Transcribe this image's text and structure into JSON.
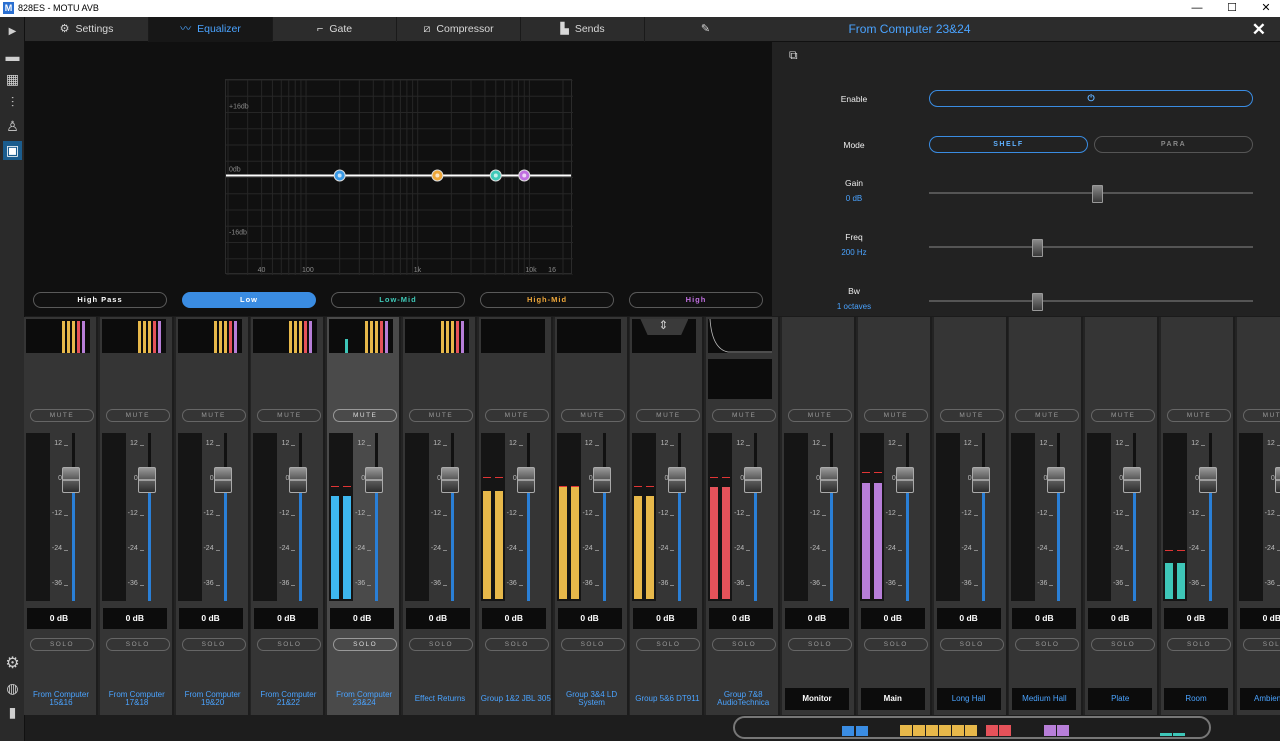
{
  "window": {
    "title": "828ES - MOTU AVB",
    "logo": "M",
    "min": "—",
    "max": "☐",
    "close": "✕"
  },
  "tabs": [
    {
      "label": "Settings",
      "icon": "gear-icon",
      "glyph": "⚙"
    },
    {
      "label": "Equalizer",
      "icon": "eq-curve-icon",
      "glyph": "〰"
    },
    {
      "label": "Gate",
      "icon": "gate-icon",
      "glyph": "⌐"
    },
    {
      "label": "Compressor",
      "icon": "compressor-icon",
      "glyph": "⧄"
    },
    {
      "label": "Sends",
      "icon": "sends-icon",
      "glyph": "▙"
    },
    {
      "label": "",
      "icon": "pencil-icon",
      "glyph": "✎"
    }
  ],
  "channel_header": {
    "name": "From Computer 23&24",
    "close": "✕"
  },
  "eq": {
    "db_labels": [
      "+16db",
      "0db",
      "-16db"
    ],
    "freq_labels": [
      "40",
      "100",
      "1k",
      "10k",
      "16"
    ],
    "bands": [
      {
        "label": "High Pass",
        "color": "#ffffff"
      },
      {
        "label": "Low",
        "color": "#ffffff"
      },
      {
        "label": "Low-Mid",
        "color": "#3fc9b8"
      },
      {
        "label": "High-Mid",
        "color": "#f0a83a"
      },
      {
        "label": "High",
        "color": "#c06fe0"
      }
    ],
    "nodes": [
      {
        "band": "Low",
        "freq_hz": 200,
        "gain_db": 0,
        "color": "#3a9ae6"
      },
      {
        "band": "Low-Mid",
        "freq_hz": 1500,
        "gain_db": 0,
        "color": "#f0a83a"
      },
      {
        "band": "High-Mid",
        "freq_hz": 5000,
        "gain_db": 0,
        "color": "#3fc9b8"
      },
      {
        "band": "High",
        "freq_hz": 9000,
        "gain_db": 0,
        "color": "#c06fe0"
      }
    ]
  },
  "params": {
    "copy_icon": "⧉",
    "enable": {
      "label": "Enable",
      "power": "⏻"
    },
    "mode": {
      "label": "Mode",
      "options": [
        "SHELF",
        "PARA"
      ],
      "selected": "SHELF"
    },
    "gain": {
      "label": "Gain",
      "value": "0 dB",
      "level": 0.52
    },
    "freq": {
      "label": "Freq",
      "value": "200 Hz",
      "level": 0.33
    },
    "bw": {
      "label": "Bw",
      "value": "1 octaves",
      "level": 0.33
    }
  },
  "mixer": {
    "mute_label": "MUTE",
    "solo_label": "SOLO",
    "scale": [
      "12",
      "0",
      "-12",
      "-24",
      "-36"
    ],
    "strips": [
      {
        "name": "From Computer 15&16",
        "db": "0 dB",
        "meter": "#e7b84a",
        "level": 0,
        "peak": null,
        "mini": "bars",
        "style": "blue"
      },
      {
        "name": "From Computer 17&18",
        "db": "0 dB",
        "meter": "#e7b84a",
        "level": 0,
        "peak": null,
        "mini": "bars",
        "style": "blue"
      },
      {
        "name": "From Computer 19&20",
        "db": "0 dB",
        "meter": "#e7b84a",
        "level": 0,
        "peak": null,
        "mini": "bars",
        "style": "blue"
      },
      {
        "name": "From Computer 21&22",
        "db": "0 dB",
        "meter": "#e7b84a",
        "level": 0,
        "peak": null,
        "mini": "bars",
        "style": "blue"
      },
      {
        "name": "From Computer 23&24",
        "db": "0 dB",
        "meter": "#3eb7ef",
        "level": 0.63,
        "peak": 0.68,
        "mini": "bars-cyan",
        "style": "blue",
        "selected": true
      },
      {
        "name": "Effect   Returns",
        "db": "0 dB",
        "meter": "#e7b84a",
        "level": 0,
        "peak": null,
        "mini": "bars",
        "style": "blue"
      },
      {
        "name": "Group 1&2 JBL 305",
        "db": "0 dB",
        "meter": "#e7b84a",
        "level": 0.66,
        "peak": 0.74,
        "mini": "empty",
        "style": "blue"
      },
      {
        "name": "Group 3&4 LD System",
        "db": "0 dB",
        "meter": "#e7b84a",
        "level": 0.68,
        "peak": 0.68,
        "mini": "empty",
        "style": "blue"
      },
      {
        "name": "Group 5&6 DT911",
        "db": "0 dB",
        "meter": "#e7b84a",
        "level": 0.63,
        "peak": 0.68,
        "mini": "collapse",
        "style": "blue"
      },
      {
        "name": "Group 7&8 AudioTechnica",
        "db": "0 dB",
        "meter": "#e5525a",
        "level": 0.68,
        "peak": 0.74,
        "mini": "curve",
        "style": "blue"
      },
      {
        "name": "Monitor",
        "db": "0 dB",
        "meter": "#e7b84a",
        "level": 0,
        "peak": null,
        "mini": "none",
        "style": "white"
      },
      {
        "name": "Main",
        "db": "0 dB",
        "meter": "#b77ed8",
        "level": 0.71,
        "peak": 0.77,
        "mini": "none",
        "style": "white"
      },
      {
        "name": "Long Hall",
        "db": "0 dB",
        "meter": "#e7b84a",
        "level": 0,
        "peak": null,
        "mini": "none",
        "style": "blue-box"
      },
      {
        "name": "Medium Hall",
        "db": "0 dB",
        "meter": "#e7b84a",
        "level": 0,
        "peak": null,
        "mini": "none",
        "style": "blue-box"
      },
      {
        "name": "Plate",
        "db": "0 dB",
        "meter": "#e7b84a",
        "level": 0,
        "peak": null,
        "mini": "none",
        "style": "blue-box"
      },
      {
        "name": "Room",
        "db": "0 dB",
        "meter": "#3ec6b8",
        "level": 0.22,
        "peak": 0.29,
        "mini": "none",
        "style": "blue-box"
      },
      {
        "name": "Ambience",
        "db": "0 dB",
        "meter": "#e7b84a",
        "level": 0,
        "peak": null,
        "mini": "none",
        "style": "blue-box"
      }
    ]
  },
  "overview": {
    "colors": [
      "#3a8ce2",
      "#3a8ce2",
      "#e7b84a",
      "#e7b84a",
      "#e7b84a",
      "#e7b84a",
      "#e7b84a",
      "#e7b84a",
      "#e5525a",
      "#e5525a",
      "#b77ed8",
      "#b77ed8",
      "#3ec6b8",
      "#3ec6b8"
    ]
  }
}
